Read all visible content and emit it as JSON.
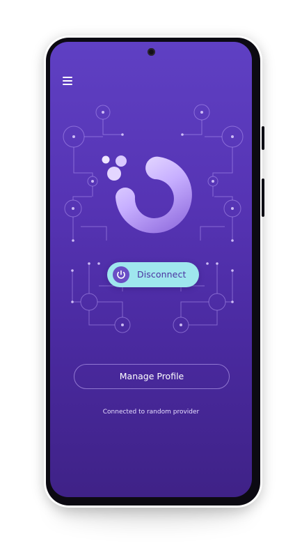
{
  "header": {
    "menu_icon": "hamburger-menu-icon"
  },
  "vpn": {
    "status_logo": "orbit-ring-logo",
    "power_icon": "power-icon",
    "disconnect_label": "Disconnect",
    "manage_profile_label": "Manage Profile",
    "status_text": "Connected to random provider"
  },
  "colors": {
    "background_top": "#5f40c3",
    "background_bottom": "#3f2287",
    "accent_button": "#9fe6ee",
    "button_text": "#4a32a0",
    "logo_ring_light": "#ece2ff",
    "logo_ring_dark": "#9d7ae6"
  }
}
